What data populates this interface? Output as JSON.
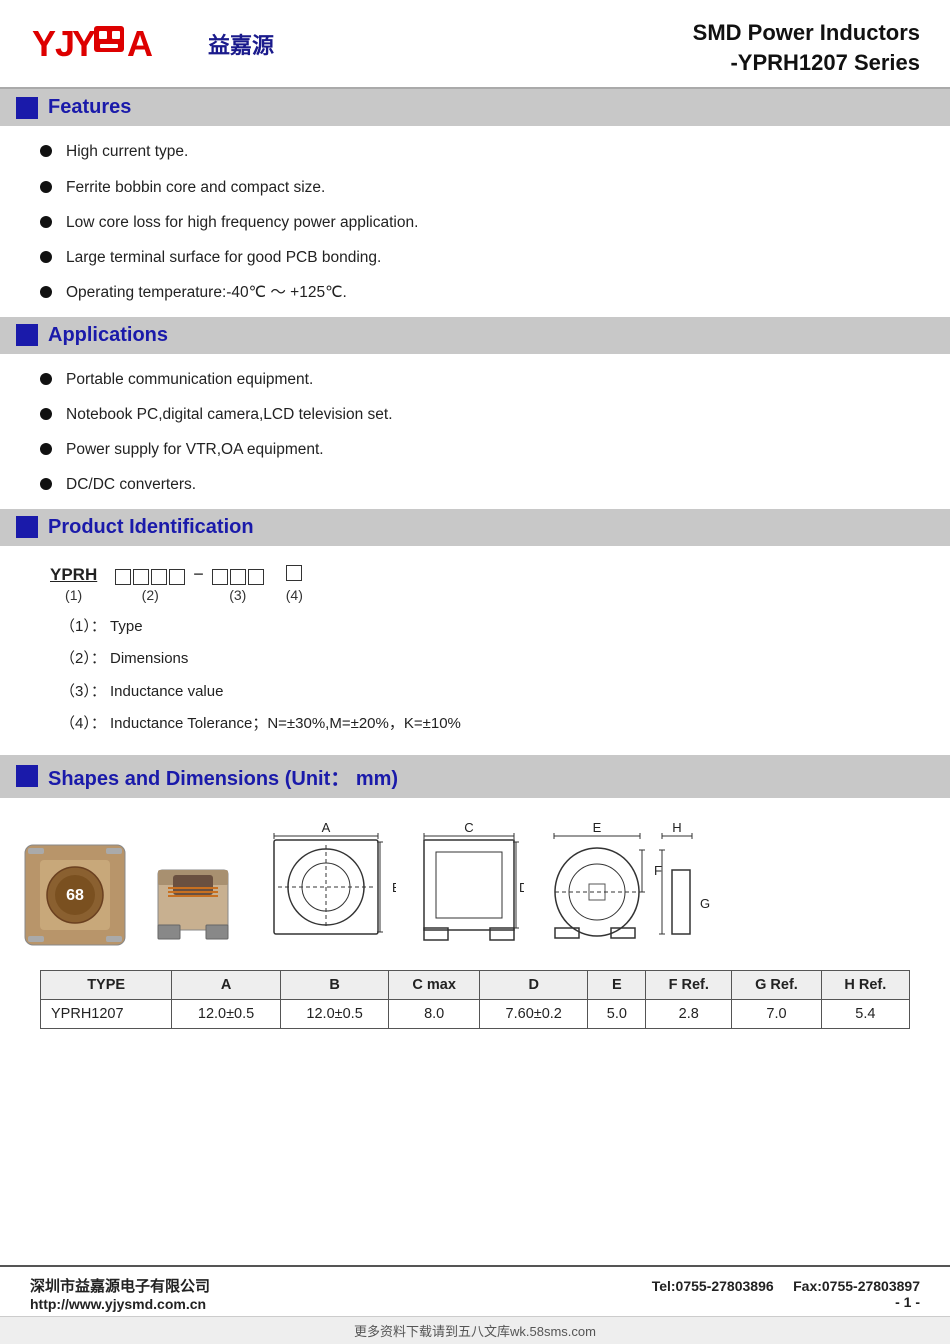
{
  "header": {
    "logo_text": "YJYCOM",
    "logo_cn": "益嘉源",
    "product_title_line1": "SMD Power Inductors",
    "product_title_line2": "-YPRH1207 Series"
  },
  "sections": {
    "features": {
      "title": "Features",
      "items": [
        "High current type.",
        "Ferrite bobbin core and compact size.",
        "Low core loss for high frequency power application.",
        "Large terminal surface for good PCB bonding.",
        "Operating temperature:-40℃ ～ +125℃."
      ]
    },
    "applications": {
      "title": "Applications",
      "items": [
        "Portable communication equipment.",
        "Notebook PC,digital camera,LCD television set.",
        "Power supply for VTR,OA equipment.",
        "DC/DC converters."
      ]
    },
    "product_id": {
      "title": "Product Identification",
      "prefix": "YPRH",
      "label1": "(1)",
      "label2": "(2)",
      "label3": "(3)",
      "label4": "(4)",
      "descriptions": [
        {
          "num": "（1）：",
          "text": "Type"
        },
        {
          "num": "（2）：",
          "text": "Dimensions"
        },
        {
          "num": "（3）：",
          "text": "Inductance value"
        },
        {
          "num": "（4）：",
          "text": "Inductance Tolerance；N=±30%,M=±20%，K=±10%"
        }
      ]
    },
    "shapes": {
      "title": "Shapes and Dimensions (Unit：  mm)",
      "dim_labels": {
        "A": "A",
        "B": "B",
        "C": "C",
        "D": "D",
        "E": "E",
        "F": "F",
        "G": "G",
        "H": "H"
      }
    }
  },
  "table": {
    "headers": [
      "TYPE",
      "A",
      "B",
      "C max",
      "D",
      "E",
      "F Ref.",
      "G Ref.",
      "H Ref."
    ],
    "rows": [
      [
        "YPRH1207",
        "12.0±0.5",
        "12.0±0.5",
        "8.0",
        "7.60±0.2",
        "5.0",
        "2.8",
        "7.0",
        "5.4"
      ]
    ]
  },
  "footer": {
    "company": "深圳市益嘉源电子有限公司",
    "website": "http://www.yjysmd.com.cn",
    "tel": "Tel:0755-27803896",
    "fax": "Fax:0755-27803897",
    "page": "- 1 -",
    "watermark": "更多资料下载请到五八文库wk.58sms.com"
  }
}
